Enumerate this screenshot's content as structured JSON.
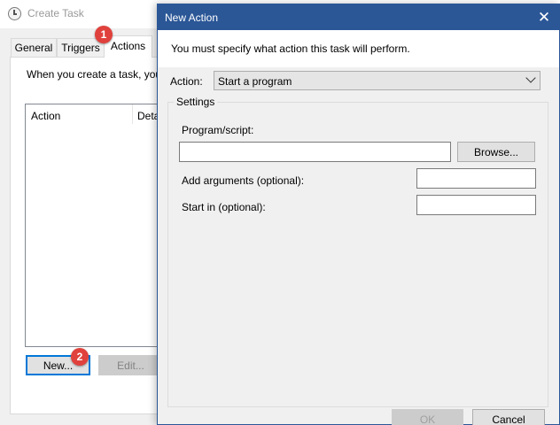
{
  "create_task": {
    "title": "Create Task",
    "tabs": [
      {
        "label": "General"
      },
      {
        "label": "Triggers"
      },
      {
        "label": "Actions"
      }
    ],
    "instruction": "When you create a task, you",
    "list_columns": [
      "Action",
      "Deta"
    ],
    "buttons": {
      "new": "New...",
      "edit": "Edit..."
    }
  },
  "markers": [
    "1",
    "2"
  ],
  "new_action": {
    "title": "New Action",
    "close_glyph": "✕",
    "instruction": "You must specify what action this task will perform.",
    "action_label": "Action:",
    "action_value": "Start a program",
    "settings_legend": "Settings",
    "program_label": "Program/script:",
    "program_value": "",
    "browse_label": "Browse...",
    "args_label": "Add arguments (optional):",
    "args_value": "",
    "startin_label": "Start in (optional):",
    "startin_value": "",
    "ok_label": "OK",
    "cancel_label": "Cancel"
  },
  "colors": {
    "dialog_titlebar": "#2b5797",
    "marker": "#e0413c",
    "focus_border": "#0078d7"
  }
}
